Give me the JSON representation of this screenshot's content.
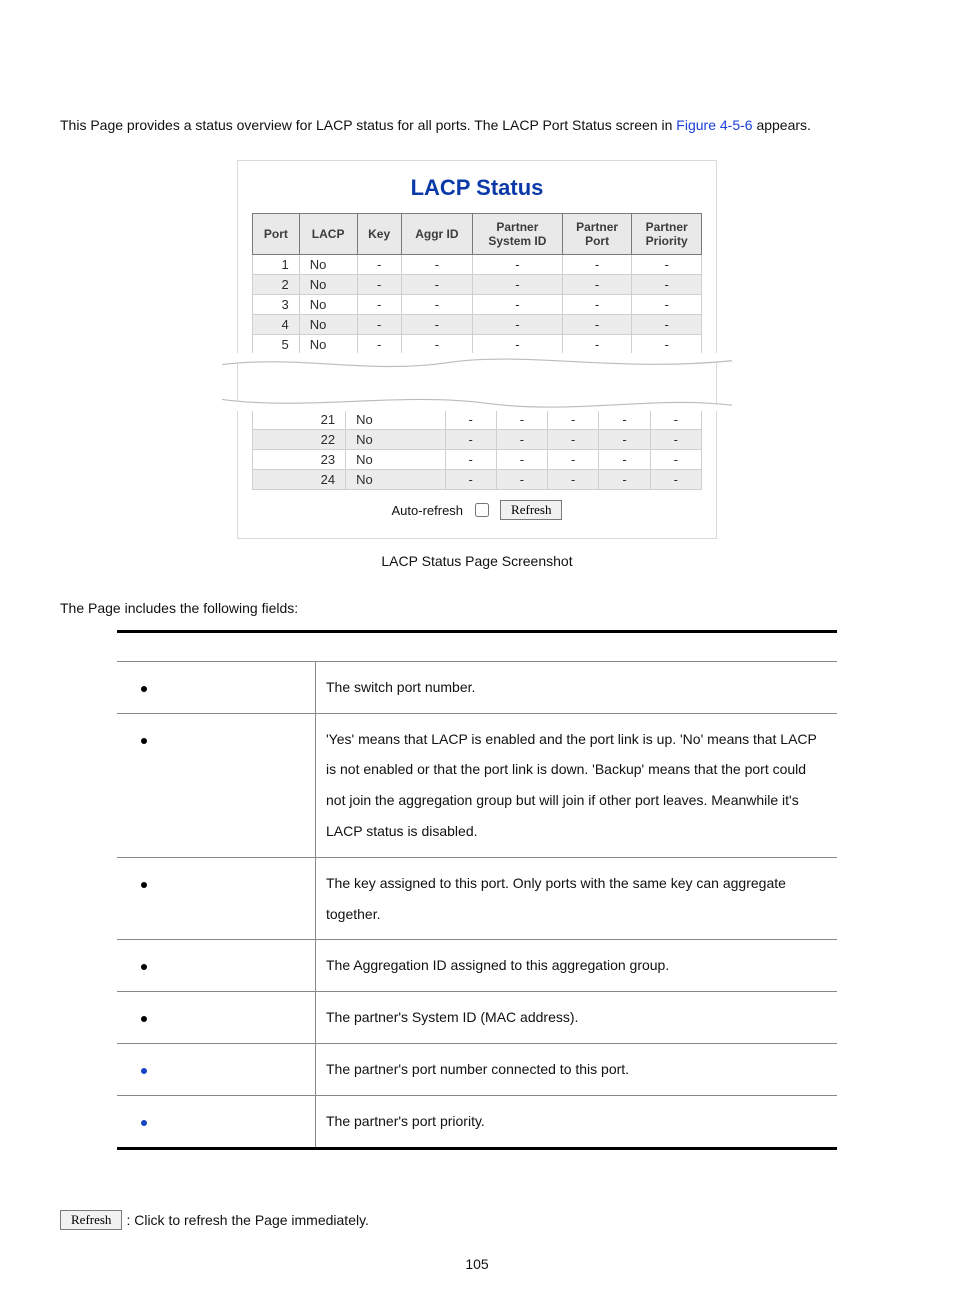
{
  "intro": {
    "before_link": "This Page provides a status overview for LACP status for all ports. The LACP Port Status screen in ",
    "link": "Figure 4-5-6",
    "after_link": " appears."
  },
  "screenshot": {
    "title": "LACP Status",
    "headers": [
      "Port",
      "LACP",
      "Key",
      "Aggr ID",
      "Partner System ID",
      "Partner Port",
      "Partner Priority"
    ],
    "rows_top": [
      {
        "port": "1",
        "lacp": "No",
        "k": "-",
        "a": "-",
        "ps": "-",
        "pp": "-",
        "pr": "-",
        "alt": false
      },
      {
        "port": "2",
        "lacp": "No",
        "k": "-",
        "a": "-",
        "ps": "-",
        "pp": "-",
        "pr": "-",
        "alt": true
      },
      {
        "port": "3",
        "lacp": "No",
        "k": "-",
        "a": "-",
        "ps": "-",
        "pp": "-",
        "pr": "-",
        "alt": false
      },
      {
        "port": "4",
        "lacp": "No",
        "k": "-",
        "a": "-",
        "ps": "-",
        "pp": "-",
        "pr": "-",
        "alt": true
      },
      {
        "port": "5",
        "lacp": "No",
        "k": "-",
        "a": "-",
        "ps": "-",
        "pp": "-",
        "pr": "-",
        "alt": false
      }
    ],
    "rows_bottom": [
      {
        "port": "21",
        "lacp": "No",
        "k": "-",
        "a": "-",
        "ps": "-",
        "pp": "-",
        "pr": "-",
        "alt": false
      },
      {
        "port": "22",
        "lacp": "No",
        "k": "-",
        "a": "-",
        "ps": "-",
        "pp": "-",
        "pr": "-",
        "alt": true
      },
      {
        "port": "23",
        "lacp": "No",
        "k": "-",
        "a": "-",
        "ps": "-",
        "pp": "-",
        "pr": "-",
        "alt": false
      },
      {
        "port": "24",
        "lacp": "No",
        "k": "-",
        "a": "-",
        "ps": "-",
        "pp": "-",
        "pr": "-",
        "alt": true
      }
    ],
    "auto_refresh_label": "Auto-refresh",
    "refresh_label": "Refresh"
  },
  "caption": "LACP Status Page Screenshot",
  "fields_intro": "The Page includes the following fields:",
  "fields": [
    {
      "desc": "The switch port number.",
      "blue": false
    },
    {
      "desc": "'Yes' means that LACP is enabled and the port link is up. 'No' means that LACP is not enabled or that the port link is down. 'Backup' means that the port could not join the aggregation group but will join if other port leaves. Meanwhile it's LACP status is disabled.",
      "blue": false
    },
    {
      "desc": "The key assigned to this port.   Only ports with the same key can aggregate together.",
      "blue": false
    },
    {
      "desc": "The Aggregation ID assigned to this aggregation group.",
      "blue": false
    },
    {
      "desc": "The partner's System ID (MAC address).",
      "blue": false
    },
    {
      "desc": "The partner's port number connected to this port.",
      "blue": true
    },
    {
      "desc": "The partner's port priority.",
      "blue": true
    }
  ],
  "refresh_button": "Refresh",
  "refresh_note": ": Click to refresh the Page immediately.",
  "page_number": "105"
}
